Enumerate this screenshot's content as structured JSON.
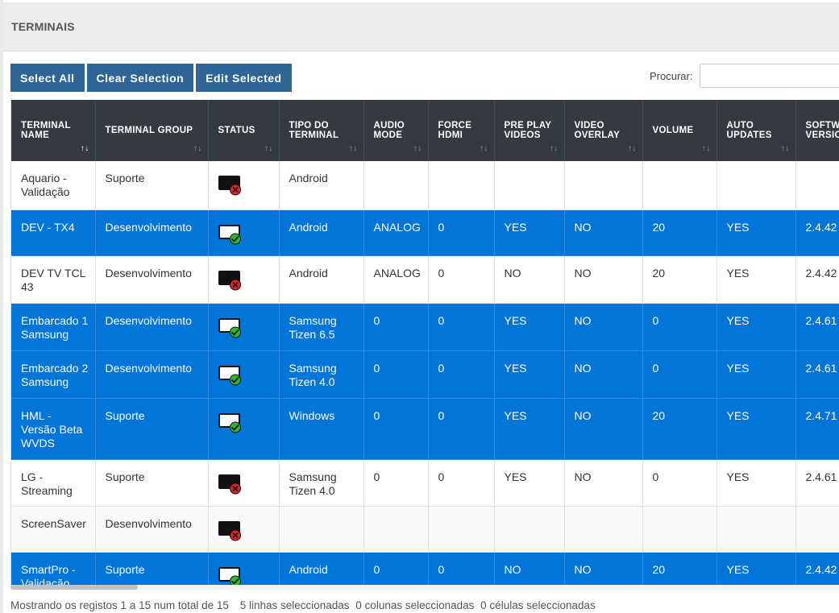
{
  "panel": {
    "title": "TERMINAIS"
  },
  "toolbar": {
    "select_all": "Select All",
    "clear_selection": "Clear Selection",
    "edit_selected": "Edit Selected"
  },
  "search": {
    "label": "Procurar:",
    "value": "",
    "placeholder": ""
  },
  "table": {
    "columns": [
      {
        "label": "TERMINAL NAME",
        "sort": "↑↓",
        "sort_active": true
      },
      {
        "label": "TERMINAL GROUP",
        "sort": "↑↓"
      },
      {
        "label": "STATUS",
        "sort": "↑↓"
      },
      {
        "label": "TIPO DO TERMINAL",
        "sort": "↑↓"
      },
      {
        "label": "AUDIO MODE",
        "sort": "↑↓"
      },
      {
        "label": "FORCE HDMI",
        "sort": "↑↓"
      },
      {
        "label": "PRE PLAY VIDEOS",
        "sort": "↑↓"
      },
      {
        "label": "VIDEO OVERLAY",
        "sort": "↑↓"
      },
      {
        "label": "VOLUME",
        "sort": "↑↓"
      },
      {
        "label": "AUTO UPDATES",
        "sort": "↑↓"
      },
      {
        "label": "SOFTWARE VERSION",
        "sort": "↑↓"
      }
    ],
    "rows": [
      {
        "name": "Aquario - Validação",
        "group": "Suporte",
        "status": "offline",
        "tipo": "Android",
        "audio": "",
        "hdmi": "",
        "preplay": "",
        "overlay": "",
        "volume": "",
        "updates": "",
        "software": "",
        "selected": false
      },
      {
        "name": "DEV - TX4",
        "group": "Desenvolvimento",
        "status": "online",
        "tipo": "Android",
        "audio": "ANALOG",
        "hdmi": "0",
        "preplay": "YES",
        "overlay": "NO",
        "volume": "20",
        "updates": "YES",
        "software": "2.4.42",
        "selected": true
      },
      {
        "name": "DEV TV TCL 43",
        "group": "Desenvolvimento",
        "status": "offline",
        "tipo": "Android",
        "audio": "ANALOG",
        "hdmi": "0",
        "preplay": "NO",
        "overlay": "NO",
        "volume": "20",
        "updates": "YES",
        "software": "2.4.42",
        "selected": false
      },
      {
        "name": "Embarcado 1 Samsung",
        "group": "Desenvolvimento",
        "status": "online",
        "tipo": "Samsung Tizen 6.5",
        "audio": "0",
        "hdmi": "0",
        "preplay": "YES",
        "overlay": "NO",
        "volume": "0",
        "updates": "YES",
        "software": "2.4.61",
        "selected": true
      },
      {
        "name": "Embarcado 2 Samsung",
        "group": "Desenvolvimento",
        "status": "online",
        "tipo": "Samsung Tizen 4.0",
        "audio": "0",
        "hdmi": "0",
        "preplay": "YES",
        "overlay": "NO",
        "volume": "0",
        "updates": "YES",
        "software": "2.4.61",
        "selected": true
      },
      {
        "name": "HML - Versão Beta WVDS",
        "group": "Suporte",
        "status": "online",
        "tipo": "Windows",
        "audio": "0",
        "hdmi": "0",
        "preplay": "YES",
        "overlay": "NO",
        "volume": "20",
        "updates": "YES",
        "software": "2.4.71",
        "selected": true
      },
      {
        "name": "LG - Streaming",
        "group": "Suporte",
        "status": "offline",
        "tipo": "Samsung Tizen 4.0",
        "audio": "0",
        "hdmi": "0",
        "preplay": "YES",
        "overlay": "NO",
        "volume": "0",
        "updates": "YES",
        "software": "2.4.61",
        "selected": false
      },
      {
        "name": "ScreenSaver",
        "group": "Desenvolvimento",
        "status": "offline",
        "tipo": "",
        "audio": "",
        "hdmi": "",
        "preplay": "",
        "overlay": "",
        "volume": "",
        "updates": "",
        "software": "",
        "selected": false
      },
      {
        "name": "SmartPro - Validação",
        "group": "Suporte",
        "status": "online",
        "tipo": "Android",
        "audio": "0",
        "hdmi": "0",
        "preplay": "NO",
        "overlay": "NO",
        "volume": "20",
        "updates": "YES",
        "software": "2.4.42",
        "selected": true
      }
    ]
  },
  "footer": {
    "records": "Mostrando os registos 1 a 15 num total de 15",
    "rows_selected": "5 linhas seleccionadas",
    "cols_selected": "0 colunas seleccionadas",
    "cells_selected": "0 células seleccionadas"
  },
  "colors": {
    "header_bg": "#343a40",
    "selected_row": "#0275d8",
    "button": "#2e6596",
    "status_online": "#2db92d",
    "status_offline": "#e02424"
  }
}
